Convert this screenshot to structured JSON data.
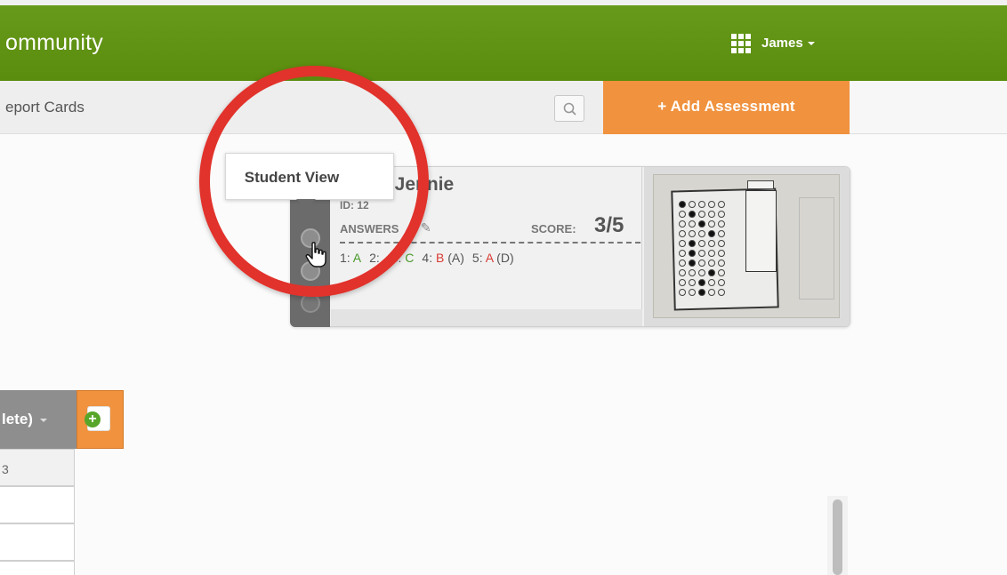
{
  "header": {
    "brand": "ommunity",
    "user_name": "James"
  },
  "subnav": {
    "link": "eport Cards",
    "add_button": "+ Add Assessment"
  },
  "student_card": {
    "tooltip": "Student View",
    "name": ", Jennie",
    "id_text": "ID: 12",
    "answers_label": "ANSWERS",
    "score_label": "SCORE:",
    "score_value": "3/5",
    "answers": [
      {
        "num": "1:",
        "letter": "A",
        "status": "correct",
        "key": ""
      },
      {
        "num": "2:",
        "letter": "",
        "status": "correct",
        "key": ""
      },
      {
        "num": "3:",
        "letter": "C",
        "status": "correct",
        "key": ""
      },
      {
        "num": "4:",
        "letter": "B",
        "status": "wrong",
        "key": "(A)"
      },
      {
        "num": "5:",
        "letter": "A",
        "status": "wrong",
        "key": "(D)"
      }
    ]
  },
  "table": {
    "header_label": "lete)",
    "row1_text": "3"
  },
  "colors": {
    "topbar": "#5f9212",
    "accent_orange": "#f0923e",
    "annotation_red": "#e1322b",
    "correct": "#4a9a2b",
    "wrong": "#d93b32"
  }
}
